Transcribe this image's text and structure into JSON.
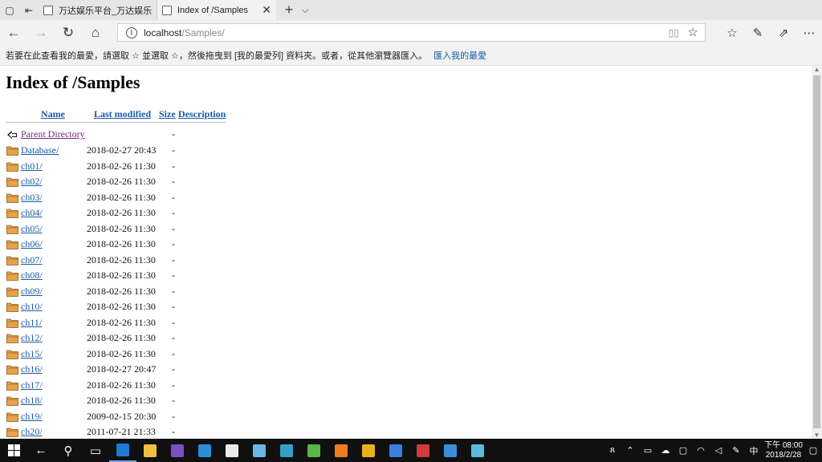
{
  "tabs": [
    {
      "title": "万达娱乐平台_万达娱乐平台",
      "active": false
    },
    {
      "title": "Index of /Samples",
      "active": true
    }
  ],
  "address": {
    "host": "localhost",
    "path": "/Samples/"
  },
  "favorites_bar": {
    "message": "若要在此查看我的最愛，請選取 ☆ 並選取 ☆，然後拖曳到 [我的最愛列] 資料夾。或者，從其他瀏覽器匯入。",
    "import_link": "匯入我的最愛"
  },
  "page": {
    "title": "Index of /Samples",
    "headers": {
      "name": "Name",
      "modified": "Last modified",
      "size": "Size",
      "description": "Description"
    },
    "parent": {
      "name": "Parent Directory",
      "size": "-"
    },
    "rows": [
      {
        "name": "Database/",
        "modified": "2018-02-27 20:43",
        "size": "-"
      },
      {
        "name": "ch01/",
        "modified": "2018-02-26 11:30",
        "size": "-"
      },
      {
        "name": "ch02/",
        "modified": "2018-02-26 11:30",
        "size": "-"
      },
      {
        "name": "ch03/",
        "modified": "2018-02-26 11:30",
        "size": "-"
      },
      {
        "name": "ch04/",
        "modified": "2018-02-26 11:30",
        "size": "-"
      },
      {
        "name": "ch05/",
        "modified": "2018-02-26 11:30",
        "size": "-"
      },
      {
        "name": "ch06/",
        "modified": "2018-02-26 11:30",
        "size": "-"
      },
      {
        "name": "ch07/",
        "modified": "2018-02-26 11:30",
        "size": "-"
      },
      {
        "name": "ch08/",
        "modified": "2018-02-26 11:30",
        "size": "-"
      },
      {
        "name": "ch09/",
        "modified": "2018-02-26 11:30",
        "size": "-"
      },
      {
        "name": "ch10/",
        "modified": "2018-02-26 11:30",
        "size": "-"
      },
      {
        "name": "ch11/",
        "modified": "2018-02-26 11:30",
        "size": "-"
      },
      {
        "name": "ch12/",
        "modified": "2018-02-26 11:30",
        "size": "-"
      },
      {
        "name": "ch15/",
        "modified": "2018-02-26 11:30",
        "size": "-"
      },
      {
        "name": "ch16/",
        "modified": "2018-02-27 20:47",
        "size": "-"
      },
      {
        "name": "ch17/",
        "modified": "2018-02-26 11:30",
        "size": "-"
      },
      {
        "name": "ch18/",
        "modified": "2018-02-26 11:30",
        "size": "-"
      },
      {
        "name": "ch19/",
        "modified": "2009-02-15 20:30",
        "size": "-"
      },
      {
        "name": "ch20/",
        "modified": "2011-07-21 21:33",
        "size": "-"
      }
    ]
  },
  "taskbar": {
    "apps": [
      {
        "icon": "edge-icon",
        "color": "#1f7ad6"
      },
      {
        "icon": "file-explorer-icon",
        "color": "#f0c043"
      },
      {
        "icon": "visual-studio-icon",
        "color": "#7a4fc4"
      },
      {
        "icon": "app-blue-icon",
        "color": "#2a8ed8"
      },
      {
        "icon": "chrome-doc-icon",
        "color": "#e9e9e9"
      },
      {
        "icon": "notepad-icon",
        "color": "#6bb6e6"
      },
      {
        "icon": "app-teal-icon",
        "color": "#35a0c8"
      },
      {
        "icon": "app-green-icon",
        "color": "#5ab54a"
      },
      {
        "icon": "xampp-icon",
        "color": "#f07b22"
      },
      {
        "icon": "chrome-icon",
        "color": "#e9b21c"
      },
      {
        "icon": "chrome-blue-icon",
        "color": "#3a7fe0"
      },
      {
        "icon": "app-red-icon",
        "color": "#d23b3b"
      },
      {
        "icon": "calendar-icon",
        "color": "#3c8edb"
      },
      {
        "icon": "app-cyan-icon",
        "color": "#5fb8de"
      }
    ],
    "ime": "中",
    "time": "下午 08:00",
    "date": "2018/2/28"
  }
}
